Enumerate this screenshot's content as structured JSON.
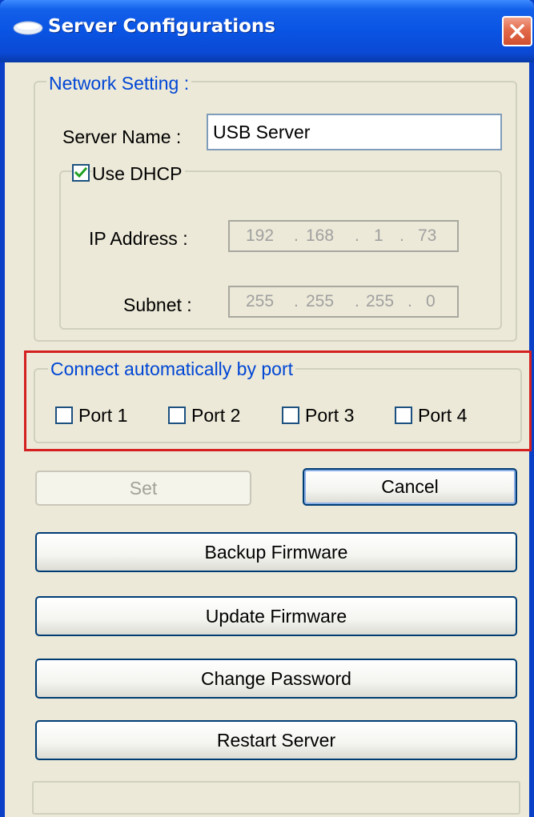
{
  "window": {
    "title": "Server Configurations"
  },
  "network": {
    "legend": "Network Setting :",
    "server_name_label": "Server Name :",
    "server_name_value": "USB Server",
    "dhcp_label": "Use DHCP",
    "dhcp_checked": true,
    "ip_label": "IP Address :",
    "ip_octets": [
      "192",
      "168",
      "1",
      "73"
    ],
    "subnet_label": "Subnet :",
    "subnet_octets": [
      "255",
      "255",
      "255",
      "0"
    ],
    "ip_separator": "."
  },
  "ports": {
    "legend": "Connect automatically by port",
    "items": [
      {
        "label": "Port 1",
        "checked": false
      },
      {
        "label": "Port 2",
        "checked": false
      },
      {
        "label": "Port 3",
        "checked": false
      },
      {
        "label": "Port 4",
        "checked": false
      }
    ]
  },
  "buttons": {
    "set": "Set",
    "cancel": "Cancel",
    "backup": "Backup Firmware",
    "update": "Update Firmware",
    "change_password": "Change Password",
    "restart": "Restart Server"
  },
  "icons": {
    "window": "server-icon",
    "close": "close-icon",
    "check": "checkmark-icon"
  },
  "colors": {
    "titlebar": "#0a54e3",
    "highlight": "#d42020",
    "group_text": "#0046d5",
    "check_mark": "#21a121"
  }
}
